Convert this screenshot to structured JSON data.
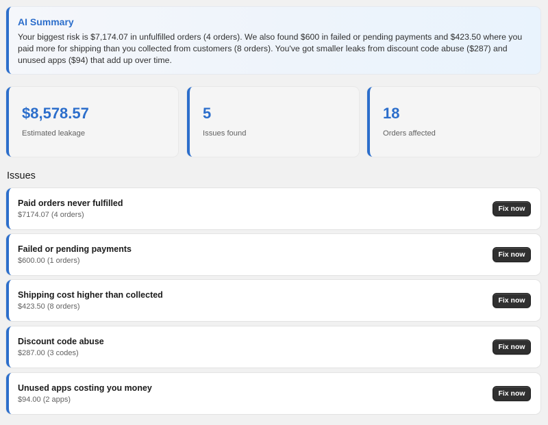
{
  "ai_summary": {
    "title": "AI Summary",
    "text": "Your biggest risk is $7,174.07 in unfulfilled orders (4 orders). We also found $600 in failed or pending payments and $423.50 where you paid more for shipping than you collected from customers (8 orders). You've got smaller leaks from discount code abuse ($287) and unused apps ($94) that add up over time."
  },
  "stats": [
    {
      "value": "$8,578.57",
      "label": "Estimated leakage"
    },
    {
      "value": "5",
      "label": "Issues found"
    },
    {
      "value": "18",
      "label": "Orders affected"
    }
  ],
  "issues_section": {
    "title": "Issues"
  },
  "issues": [
    {
      "title": "Paid orders never fulfilled",
      "detail": "$7174.07 (4 orders)",
      "action": "Fix now"
    },
    {
      "title": "Failed or pending payments",
      "detail": "$600.00 (1 orders)",
      "action": "Fix now"
    },
    {
      "title": "Shipping cost higher than collected",
      "detail": "$423.50 (8 orders)",
      "action": "Fix now"
    },
    {
      "title": "Discount code abuse",
      "detail": "$287.00 (3 codes)",
      "action": "Fix now"
    },
    {
      "title": "Unused apps costing you money",
      "detail": "$94.00 (2 apps)",
      "action": "Fix now"
    }
  ],
  "colors": {
    "accent": "#2c6ecb",
    "button_bg": "#303030",
    "page_bg": "#f1f1f1"
  }
}
